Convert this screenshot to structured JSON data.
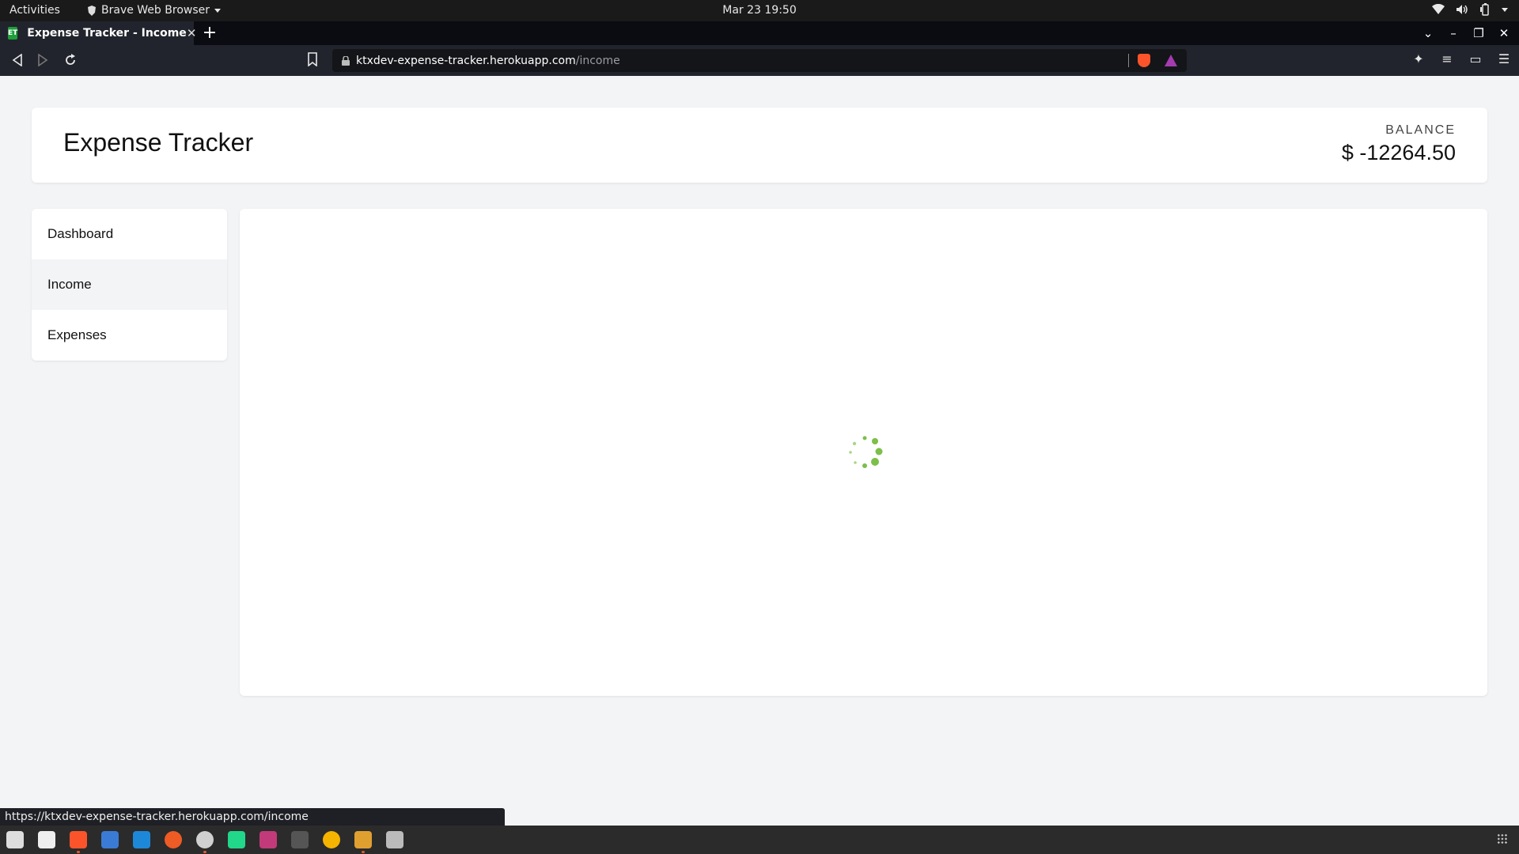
{
  "system": {
    "activities": "Activities",
    "app_name": "Brave Web Browser",
    "clock": "Mar 23  19:50"
  },
  "browser": {
    "tab": {
      "favicon_text": "ET",
      "title": "Expense Tracker - Income"
    },
    "url_host": "ktxdev-expense-tracker.herokuapp.com",
    "url_path": "/income",
    "status_url": "https://ktxdev-expense-tracker.herokuapp.com/income"
  },
  "app": {
    "title": "Expense Tracker",
    "balance_label": "BALANCE",
    "balance_value": "$ -12264.50",
    "nav": [
      {
        "label": "Dashboard",
        "active": false
      },
      {
        "label": "Income",
        "active": true
      },
      {
        "label": "Expenses",
        "active": false
      }
    ],
    "spinner_color": "#7cbf4a"
  },
  "colors": {
    "tab_favicon": "#1e9e3c",
    "brave_orange": "#fb542b",
    "rewards_purple": "#a53bb0"
  },
  "dock": {
    "icons": [
      "files-icon",
      "downloads-icon",
      "brave-icon",
      "thunderbird-icon",
      "vscode-icon",
      "postman-icon",
      "obs-icon",
      "pycharm-icon",
      "intellij-icon",
      "terminal-icon",
      "chrome-icon",
      "insomnia-icon",
      "text-editor-icon"
    ]
  }
}
